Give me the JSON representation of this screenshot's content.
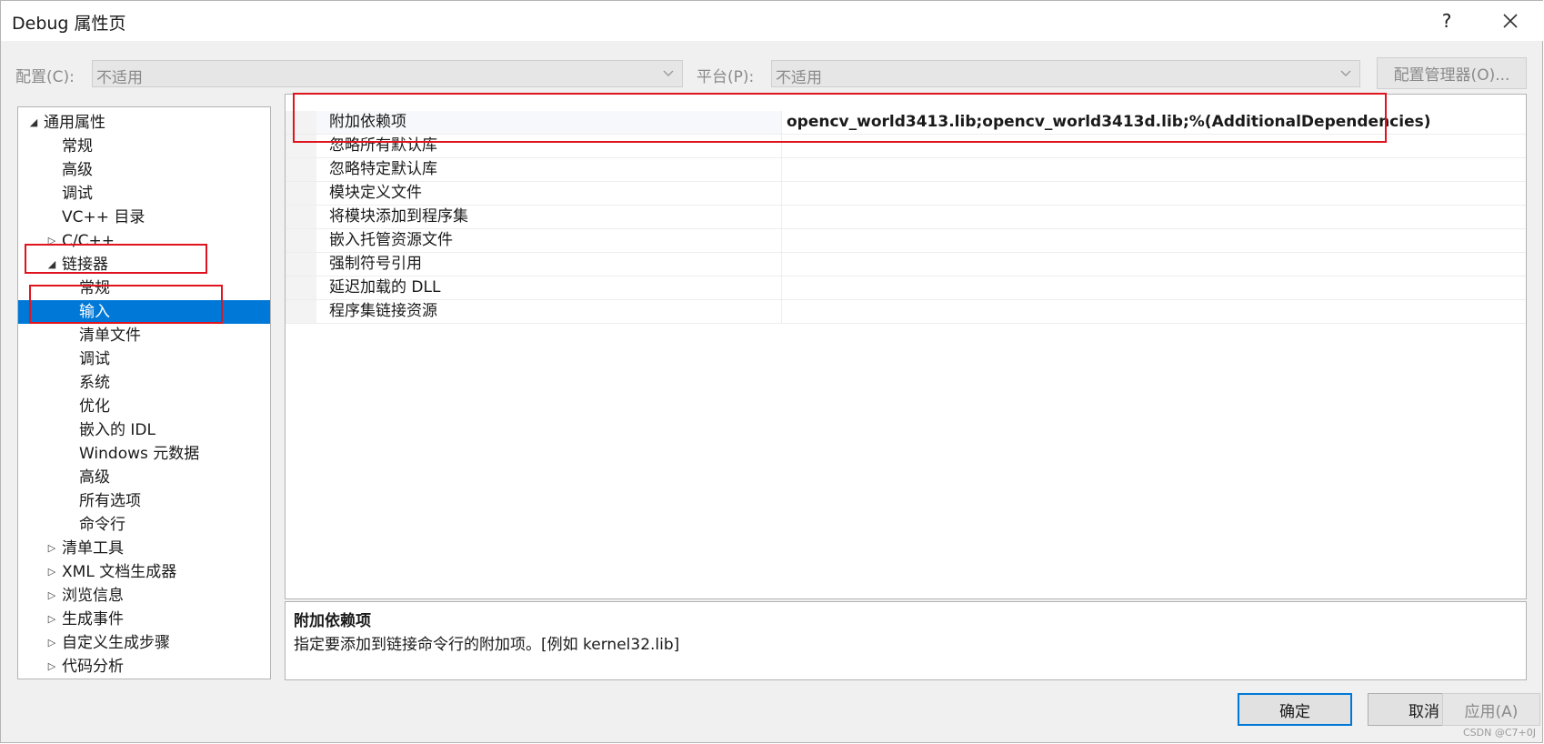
{
  "window": {
    "title": "Debug 属性页",
    "help": "?",
    "close_icon": "close-icon"
  },
  "config": {
    "config_label": "配置(C):",
    "config_value": "不适用",
    "platform_label": "平台(P):",
    "platform_value": "不适用",
    "manager_button": "配置管理器(O)..."
  },
  "tree": {
    "items": [
      {
        "label": "通用属性",
        "level": 0,
        "expander": "expanded"
      },
      {
        "label": "常规",
        "level": 1,
        "expander": "none"
      },
      {
        "label": "高级",
        "level": 1,
        "expander": "none"
      },
      {
        "label": "调试",
        "level": 1,
        "expander": "none"
      },
      {
        "label": "VC++ 目录",
        "level": 1,
        "expander": "none"
      },
      {
        "label": "C/C++",
        "level": 1,
        "expander": "collapsed"
      },
      {
        "label": "链接器",
        "level": 1,
        "expander": "expanded"
      },
      {
        "label": "常规",
        "level": 2,
        "expander": "none"
      },
      {
        "label": "输入",
        "level": 2,
        "expander": "none",
        "selected": true
      },
      {
        "label": "清单文件",
        "level": 2,
        "expander": "none"
      },
      {
        "label": "调试",
        "level": 2,
        "expander": "none"
      },
      {
        "label": "系统",
        "level": 2,
        "expander": "none"
      },
      {
        "label": "优化",
        "level": 2,
        "expander": "none"
      },
      {
        "label": "嵌入的 IDL",
        "level": 2,
        "expander": "none"
      },
      {
        "label": "Windows 元数据",
        "level": 2,
        "expander": "none"
      },
      {
        "label": "高级",
        "level": 2,
        "expander": "none"
      },
      {
        "label": "所有选项",
        "level": 2,
        "expander": "none"
      },
      {
        "label": "命令行",
        "level": 2,
        "expander": "none"
      },
      {
        "label": "清单工具",
        "level": 1,
        "expander": "collapsed"
      },
      {
        "label": "XML 文档生成器",
        "level": 1,
        "expander": "collapsed"
      },
      {
        "label": "浏览信息",
        "level": 1,
        "expander": "collapsed"
      },
      {
        "label": "生成事件",
        "level": 1,
        "expander": "collapsed"
      },
      {
        "label": "自定义生成步骤",
        "level": 1,
        "expander": "collapsed"
      },
      {
        "label": "代码分析",
        "level": 1,
        "expander": "collapsed"
      }
    ]
  },
  "properties": [
    {
      "name": "附加依赖项",
      "value": "opencv_world3413.lib;opencv_world3413d.lib;%(AdditionalDependencies)"
    },
    {
      "name": "忽略所有默认库",
      "value": ""
    },
    {
      "name": "忽略特定默认库",
      "value": ""
    },
    {
      "name": "模块定义文件",
      "value": ""
    },
    {
      "name": "将模块添加到程序集",
      "value": ""
    },
    {
      "name": "嵌入托管资源文件",
      "value": ""
    },
    {
      "name": "强制符号引用",
      "value": ""
    },
    {
      "name": "延迟加载的 DLL",
      "value": ""
    },
    {
      "name": "程序集链接资源",
      "value": ""
    }
  ],
  "description": {
    "title": "附加依赖项",
    "text": "指定要添加到链接命令行的附加项。[例如 kernel32.lib]"
  },
  "buttons": {
    "ok": "确定",
    "cancel": "取消",
    "apply": "应用(A)"
  },
  "watermark": "CSDN @C7+0J",
  "colors": {
    "selection": "#0078d7",
    "annotation": "#e0141e"
  }
}
